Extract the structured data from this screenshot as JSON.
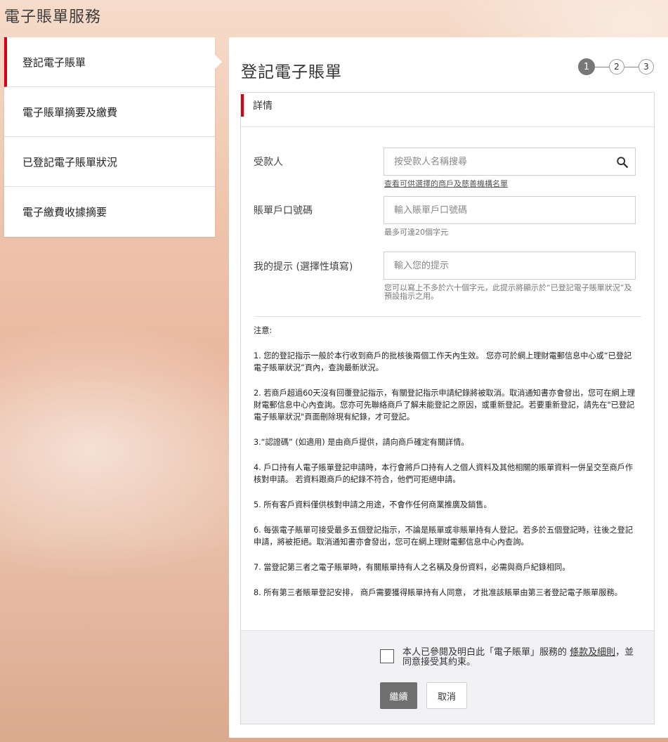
{
  "app": {
    "title": "電子賬單服務"
  },
  "sidebar": {
    "items": [
      {
        "label": "登記電子賬單",
        "active": true
      },
      {
        "label": "電子賬單摘要及繳費"
      },
      {
        "label": "已登記電子賬單狀況"
      },
      {
        "label": "電子繳費收據摘要"
      }
    ]
  },
  "main": {
    "title": "登記電子賬單",
    "steps": [
      "1",
      "2",
      "3"
    ],
    "current_step": "1",
    "section_title": "詳情",
    "form": {
      "payee": {
        "label": "受款人",
        "placeholder": "按受款人名稱搜尋",
        "value": "",
        "helper_link": "查看可供選擇的商戶及慈善機構名單",
        "icon": "search-icon"
      },
      "account": {
        "label": "賬單戶口號碼",
        "placeholder": "輸入賬單戶口號碼",
        "value": "",
        "helper": "最多可達20個字元"
      },
      "reminder": {
        "label": "我的提示 (選擇性填寫)",
        "placeholder": "輸入您的提示",
        "value": "",
        "helper": "您可以寫上不多於六十個字元，此提示將顯示於“已登記電子賬單狀況”及預設指示之用。"
      }
    },
    "notes": {
      "heading": "注意:",
      "items": [
        "1. 您的登記指示一般於本行收到商戶的批核後兩個工作天內生效。 您亦可於網上理財電郵信息中心或“已登記電子賬單狀況”頁內，查詢最新狀況。",
        "2. 若商戶超過60天沒有回覆登記指示，有關登記指示申請紀錄將被取消。取消通知書亦會發出，您可在網上理財電郵信息中心內查詢。您亦可先聯絡商戶了解未能登記之原因，或重新登記。若要重新登記，請先在\"已登記電子賬單狀況\"頁面刪除現有紀錄，才可登記。",
        "3.“認證碼” (如適用) 是由商戶提供，請向商戶確定有關詳情。",
        "4. 戶口持有人電子賬單登記申請時，本行會將戶口持有人之個人資料及其他相關的賬單資料一併呈交至商戶作核對申請。 若資料跟商戶的紀錄不符合，他們可拒絕申請。",
        "5. 所有客戶資料僅供核對申請之用途，不會作任何商業推廣及銷售。",
        "6. 每張電子賬單可接受最多五個登記指示，不論是賬單或非賬單持有人登記。若多於五個登記時，往後之登記申請，將被拒絕。取消通知書亦會發出，您可在網上理財電郵信息中心內查詢。",
        "7. 當登記第三者之電子賬單時，有關賬單持有人之名稱及身份資料，必需與商戶紀錄相同。",
        "8. 所有第三者賬單登記安排， 商戶需要獲得賬單持有人同意， 才批准該賬單由第三者登記電子賬單服務。"
      ]
    },
    "agreement": {
      "text_before": "本人已參閱及明白此「電子賬單」服務的 ",
      "link": "條款及細則",
      "text_after": "，並同意接受其約束。",
      "checked": false
    },
    "buttons": {
      "continue": "繼續",
      "cancel": "取消"
    }
  },
  "colors": {
    "accent": "#db0011",
    "primary_button": "#6f6f6f"
  }
}
